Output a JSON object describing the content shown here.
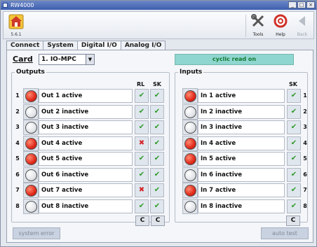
{
  "window": {
    "title": "RW4000"
  },
  "toolbar": {
    "version": "5.6.1",
    "tools_label": "Tools",
    "help_label": "Help",
    "back_label": "Back"
  },
  "tabs": [
    {
      "label": "Connect"
    },
    {
      "label": "System"
    },
    {
      "label": "Digital I/O"
    },
    {
      "label": "Analog I/O"
    }
  ],
  "card": {
    "label": "Card",
    "selected": "1. IO-MPC"
  },
  "status": "cyclic read on",
  "outputs": {
    "title": "Outputs",
    "col_rl": "RL",
    "col_sk": "SK",
    "rows": [
      {
        "num": "1",
        "label": "Out 1 active",
        "state": "on",
        "rl": "ok",
        "sk": "ok"
      },
      {
        "num": "2",
        "label": "Out 2 inactive",
        "state": "off",
        "rl": "ok",
        "sk": "ok"
      },
      {
        "num": "3",
        "label": "Out 3 inactive",
        "state": "off",
        "rl": "ok",
        "sk": "ok"
      },
      {
        "num": "4",
        "label": "Out 4 active",
        "state": "on",
        "rl": "bad",
        "sk": "ok"
      },
      {
        "num": "5",
        "label": "Out 5 active",
        "state": "on",
        "rl": "ok",
        "sk": "ok"
      },
      {
        "num": "6",
        "label": "Out 6 inactive",
        "state": "off",
        "rl": "ok",
        "sk": "ok"
      },
      {
        "num": "7",
        "label": "Out 7 active",
        "state": "on",
        "rl": "bad",
        "sk": "ok"
      },
      {
        "num": "8",
        "label": "Out 8 inactive",
        "state": "off",
        "rl": "ok",
        "sk": "ok"
      }
    ],
    "c1": "C",
    "c2": "C"
  },
  "inputs": {
    "title": "Inputs",
    "col_sk": "SK",
    "rows": [
      {
        "num": "1",
        "label": "In 1 active",
        "state": "on",
        "sk": "ok"
      },
      {
        "num": "2",
        "label": "In 2 inactive",
        "state": "off",
        "sk": "ok"
      },
      {
        "num": "3",
        "label": "In 3 inactive",
        "state": "off",
        "sk": "ok"
      },
      {
        "num": "4",
        "label": "In 4 active",
        "state": "on",
        "sk": "ok"
      },
      {
        "num": "5",
        "label": "In 5 active",
        "state": "on",
        "sk": "ok"
      },
      {
        "num": "6",
        "label": "In 6 inactive",
        "state": "off",
        "sk": "ok"
      },
      {
        "num": "7",
        "label": "In 7 active",
        "state": "on",
        "sk": "ok"
      },
      {
        "num": "8",
        "label": "In 8 inactive",
        "state": "off",
        "sk": "ok"
      }
    ],
    "c": "C"
  },
  "buttons": {
    "system_error": "system error",
    "auto_test": "auto test"
  },
  "colors": {
    "active_led": "#e0281a",
    "status_bg": "#8fd6d0",
    "status_text": "#137a30",
    "check_ok": "#2e9a28",
    "check_bad": "#d3262b"
  }
}
